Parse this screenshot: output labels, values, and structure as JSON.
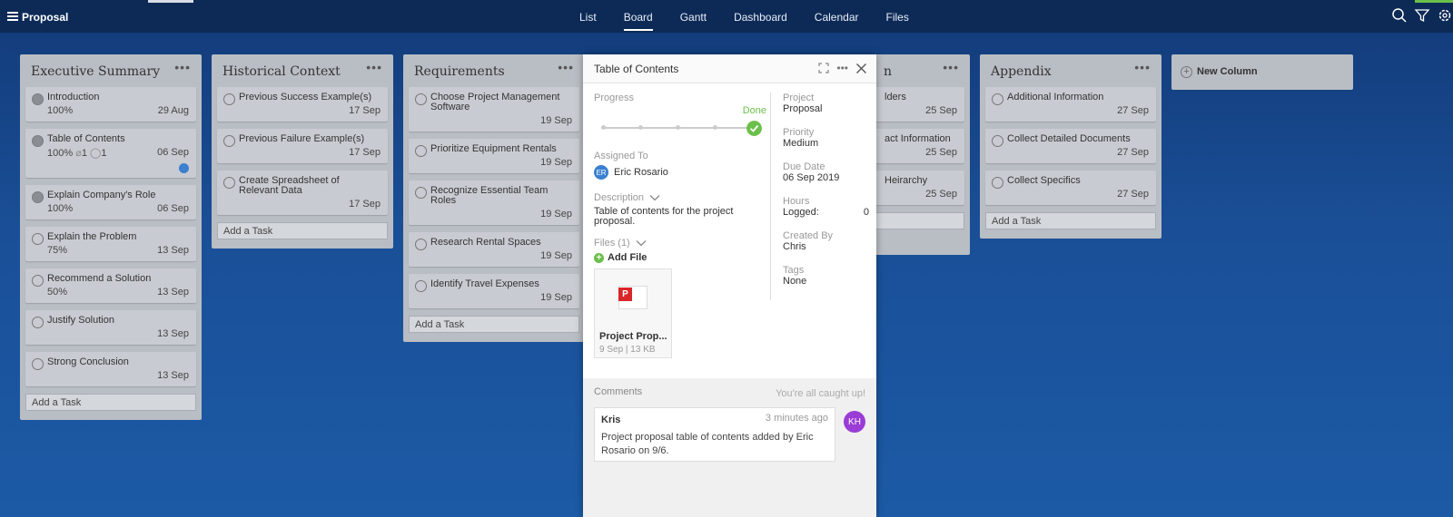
{
  "app": {
    "title": "Proposal"
  },
  "nav": [
    {
      "label": "List"
    },
    {
      "label": "Board"
    },
    {
      "label": "Gantt"
    },
    {
      "label": "Dashboard"
    },
    {
      "label": "Calendar"
    },
    {
      "label": "Files"
    }
  ],
  "columns": [
    {
      "title": "Executive Summary",
      "tasks": [
        {
          "name": "Introduction",
          "pct": "100%",
          "date": "29 Aug"
        },
        {
          "name": "Table of Contents",
          "pct": "100%",
          "attachments": "1",
          "comments": "1",
          "date": "06 Sep"
        },
        {
          "name": "Explain Company's Role",
          "pct": "100%",
          "date": "06 Sep"
        },
        {
          "name": "Explain the Problem",
          "pct": "75%",
          "date": "13 Sep"
        },
        {
          "name": "Recommend a Solution",
          "pct": "50%",
          "date": "13 Sep"
        },
        {
          "name": "Justify Solution",
          "date": "13 Sep"
        },
        {
          "name": "Strong Conclusion",
          "date": "13 Sep"
        }
      ],
      "add_task": "Add a Task"
    },
    {
      "title": "Historical Context",
      "tasks": [
        {
          "name": "Previous Success Example(s)",
          "date": "17 Sep"
        },
        {
          "name": "Previous Failure Example(s)",
          "date": "17 Sep"
        },
        {
          "name": "Create Spreadsheet of Relevant Data",
          "date": "17 Sep"
        }
      ],
      "add_task": "Add a Task"
    },
    {
      "title": "Requirements",
      "tasks": [
        {
          "name": "Choose Project Management Software",
          "date": "19 Sep"
        },
        {
          "name": "Prioritize Equipment Rentals",
          "date": "19 Sep"
        },
        {
          "name": "Recognize Essential Team Roles",
          "date": "19 Sep"
        },
        {
          "name": "Research Rental Spaces",
          "date": "19 Sep"
        },
        {
          "name": "Identify Travel Expenses",
          "date": "19 Sep"
        }
      ],
      "add_task": "Add a Task"
    },
    {
      "title": "n",
      "tasks": [
        {
          "name": "lders",
          "date": "25 Sep"
        },
        {
          "name": "act Information",
          "date": "25 Sep"
        },
        {
          "name": "Heirarchy",
          "date": "25 Sep"
        }
      ]
    },
    {
      "title": "Appendix",
      "tasks": [
        {
          "name": "Additional Information",
          "date": "27 Sep"
        },
        {
          "name": "Collect Detailed Documents",
          "date": "27 Sep"
        },
        {
          "name": "Collect Specifics",
          "date": "27 Sep"
        }
      ],
      "add_task": "Add a Task"
    }
  ],
  "new_column": "New Column",
  "modal": {
    "title": "Table of Contents",
    "progress_label": "Progress",
    "progress_status": "Done",
    "progress_value": 1.0,
    "assigned_label": "Assigned To",
    "assignee_initials": "ER",
    "assignee": "Eric Rosario",
    "description_label": "Description",
    "description": "Table of contents for the project proposal.",
    "files_label": "Files (1)",
    "add_file": "Add File",
    "file": {
      "name": "Project Prop...",
      "meta": "9 Sep | 13 KB",
      "badge": "P"
    },
    "project_label": "Project",
    "project": "Proposal",
    "priority_label": "Priority",
    "priority": "Medium",
    "due_label": "Due Date",
    "due": "06 Sep 2019",
    "hours_label": "Hours",
    "logged_label": "Logged:",
    "logged": "0",
    "created_label": "Created By",
    "created": "Chris",
    "tags_label": "Tags",
    "tags": "None",
    "comments_label": "Comments",
    "caught_up": "You're all caught up!",
    "comment": {
      "author": "Kris",
      "time": "3 minutes ago",
      "text": "Project proposal table of contents added by Eric Rosario on 9/6.",
      "avatar": "KH"
    }
  },
  "colors": {
    "done": "#6cc04a",
    "topbar": "#0d2a57",
    "avatar_kh": "#9a3cd6",
    "avatar_er": "#3a7fd0"
  }
}
